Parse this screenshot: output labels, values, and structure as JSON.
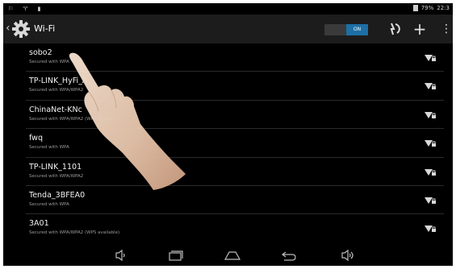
{
  "status_bar": {
    "battery_percent": "79%",
    "clock": "22:3"
  },
  "action_bar": {
    "title": "Wi-Fi",
    "toggle_label": "ON",
    "toggle_state": "on",
    "icons": [
      "back-chevron-icon",
      "settings-gear-icon",
      "wps-icon",
      "add-icon",
      "overflow-menu-icon"
    ]
  },
  "networks": [
    {
      "ssid": "sobo2",
      "security": "Secured with WPA"
    },
    {
      "ssid": "TP-LINK_HyFi_A",
      "security": "Secured with WPA/WPA2"
    },
    {
      "ssid": "ChinaNet-KNc",
      "security": "Secured with WPA/WPA2 (WPS available)"
    },
    {
      "ssid": "fwq",
      "security": "Secured with WPA"
    },
    {
      "ssid": "TP-LINK_1101",
      "security": "Secured with WPA/WPA2"
    },
    {
      "ssid": "Tenda_3BFEA0",
      "security": "Secured with WPA"
    },
    {
      "ssid": "3A01",
      "security": "Secured with WPA/WPA2 (WPS available)"
    }
  ],
  "nav_bar": {
    "icons": [
      "volume-down-icon",
      "recent-apps-icon",
      "home-icon",
      "back-icon",
      "volume-up-icon"
    ]
  },
  "colors": {
    "toggle_on": "#1d6fa5",
    "action_bar_bg": "#1c1c1c",
    "screen_bg": "#000000"
  }
}
